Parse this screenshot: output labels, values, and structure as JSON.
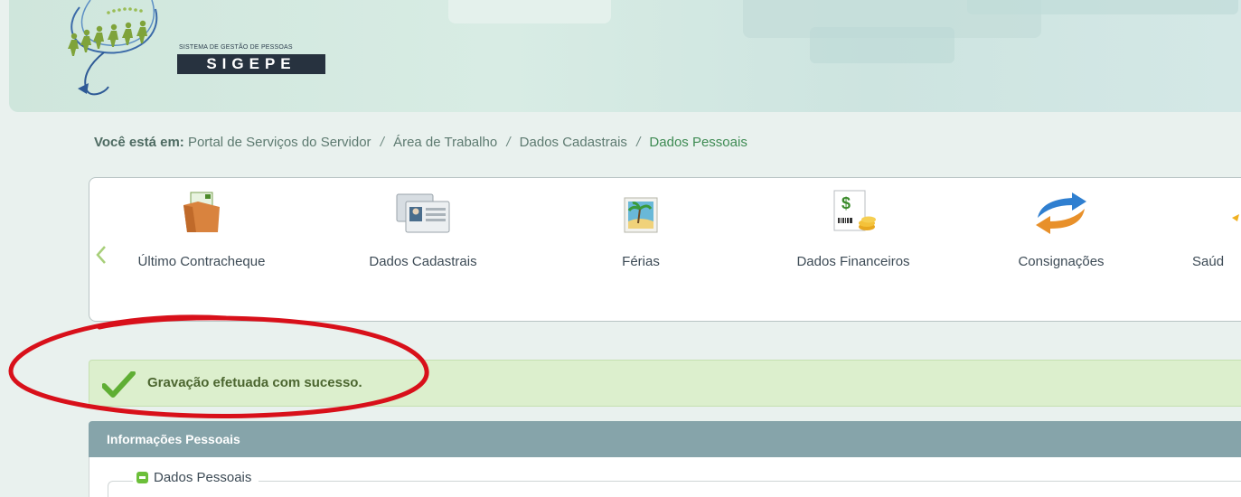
{
  "header": {
    "system_subtitle": "SISTEMA DE GESTÃO DE PESSOAS",
    "system_name": "SIGEPE"
  },
  "breadcrumb": {
    "label": "Você está em:",
    "items": [
      "Portal de Serviços do Servidor",
      "Área de Trabalho",
      "Dados Cadastrais",
      "Dados Pessoais"
    ],
    "separator": "/"
  },
  "carousel": {
    "items": [
      {
        "label": "Último Contracheque",
        "icon": "folder-icon"
      },
      {
        "label": "Dados Cadastrais",
        "icon": "id-card-icon"
      },
      {
        "label": "Férias",
        "icon": "beach-picture-icon"
      },
      {
        "label": "Dados Financeiros",
        "icon": "money-document-icon"
      },
      {
        "label": "Consignações",
        "icon": "exchange-arrows-icon"
      },
      {
        "label": "Saúd",
        "icon": "health-icon"
      }
    ]
  },
  "alert": {
    "message": "Gravação efetuada com sucesso.",
    "type": "success"
  },
  "panel": {
    "title": "Informações Pessoais",
    "section_legend": "Dados Pessoais"
  },
  "colors": {
    "header_bg": "#d4e9e1",
    "breadcrumb_current": "#3e8b53",
    "alert_bg": "#dcefcd",
    "alert_text": "#4c6630",
    "panel_head": "#86a4aa",
    "annotation": "#d8101a"
  }
}
